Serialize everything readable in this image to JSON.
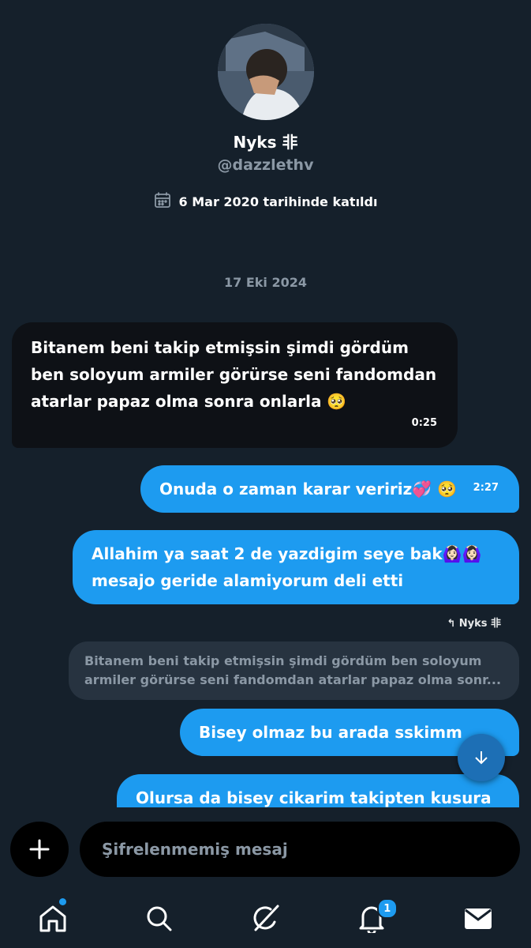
{
  "profile": {
    "name": "Nyks 非",
    "handle": "@dazzlethv",
    "joined": "6 Mar 2020 tarihinde katıldı"
  },
  "conversation": {
    "date_separator": "17 Eki 2024",
    "messages": [
      {
        "text": "Bitanem beni takip etmişsin şimdi gördüm ben soloyum armiler görürse seni fandomdan atarlar papaz olma sonra onlarla 🥺",
        "time": "0:25",
        "direction": "received"
      },
      {
        "text": "Onuda o zaman karar veririz💞 🥺",
        "time": "2:27",
        "direction": "sent"
      },
      {
        "text": "Allahim ya saat 2 de yazdigim seye bak🙆🏻‍♀️🙆🏻‍♀️ mesajo geride alamiyorum deli etti",
        "time": "",
        "direction": "sent"
      },
      {
        "text": "Bisey olmaz bu arada sskimm",
        "time": "",
        "direction": "sent"
      },
      {
        "text": "Olursa da bisey cikarim takipten kusura",
        "time": "",
        "direction": "sent"
      }
    ],
    "reply_to": "↰ Nyks 非",
    "quoted_text": "Bitanem beni takip etmişsin şimdi gördüm ben soloyum armiler görürse seni fandomdan atarlar papaz olma sonr..."
  },
  "composer": {
    "placeholder": "Şifrelenmemiş mesaj"
  },
  "tabbar": {
    "items": [
      "home-icon",
      "search-icon",
      "grok-icon",
      "notifications-icon",
      "messages-icon"
    ],
    "notifications_badge": "1"
  },
  "colors": {
    "background": "#15202b",
    "accent": "#1d9bf0",
    "received_bubble": "#0e1116",
    "muted_text": "#8b98a5"
  }
}
